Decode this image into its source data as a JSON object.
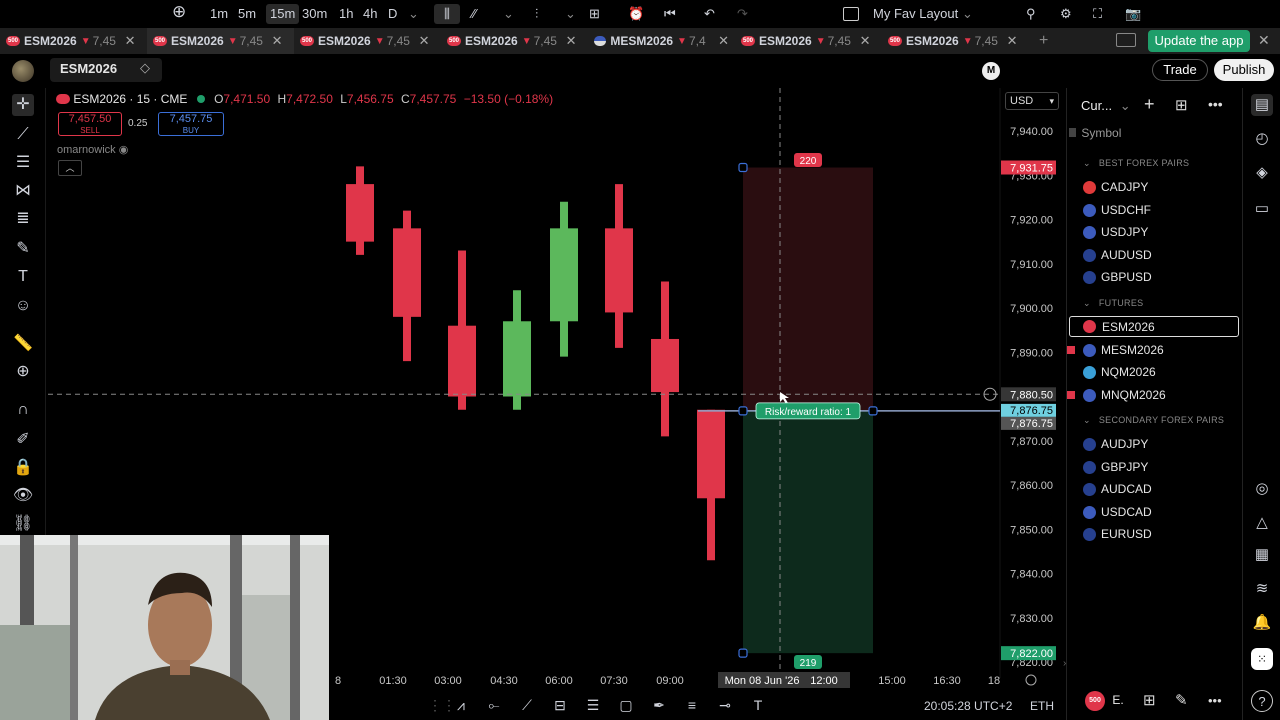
{
  "tabs": [
    {
      "symbol": "ESM2026",
      "price": "7,45",
      "logo": "500",
      "active": false
    },
    {
      "symbol": "ESM2026",
      "price": "7,45",
      "logo": "500",
      "active": true
    },
    {
      "symbol": "ESM2026",
      "price": "7,45",
      "logo": "500",
      "active": false
    },
    {
      "symbol": "ESM2026",
      "price": "7,45",
      "logo": "500",
      "active": false
    },
    {
      "symbol": "MESM2026",
      "price": "7,4",
      "logo": "flag",
      "active": false
    },
    {
      "symbol": "ESM2026",
      "price": "7,45",
      "logo": "500",
      "active": false
    },
    {
      "symbol": "ESM2026",
      "price": "7,45",
      "logo": "500",
      "active": false
    }
  ],
  "update_label": "Update the app",
  "toolbar": {
    "symbol": "ESM2026",
    "timeframes": [
      "1m",
      "5m",
      "15m",
      "30m",
      "1h",
      "4h",
      "D"
    ],
    "active_timeframe": "15m",
    "layout_name": "My Fav Layout",
    "layout_avatar": "M",
    "trade_label": "Trade",
    "publish_label": "Publish"
  },
  "chart": {
    "title": "ESM2026 · 15 · CME",
    "open_label": "O",
    "open": "7,471.50",
    "high_label": "H",
    "high": "7,472.50",
    "low_label": "L",
    "low": "7,456.75",
    "close_label": "C",
    "close": "7,457.75",
    "change": "−13.50 (−0.18%)",
    "sell_price": "7,457.50",
    "sell_label": "SELL",
    "buy_price": "7,457.75",
    "buy_label": "BUY",
    "spread": "0.25",
    "username": "omarnowick",
    "currency": "USD",
    "target_ticks": "220",
    "stop_ticks": "219",
    "rr_label": "Risk/reward ratio: 1",
    "crosshair_price": "7,880.50",
    "entry_price": "7,876.75",
    "entry_price_2": "7,876.75",
    "target_price": "7,931.75",
    "stop_price": "7,822.00",
    "crosshair_date": "Mon 08 Jun '26",
    "crosshair_time": "12:00",
    "y_ticks": [
      "7,940.00",
      "7,930.00",
      "7,920.00",
      "7,910.00",
      "7,900.00",
      "7,890.00",
      "7,870.00",
      "7,860.00",
      "7,850.00",
      "7,840.00",
      "7,830.00",
      "7,820.00"
    ],
    "x_ticks": [
      "8",
      "01:30",
      "03:00",
      "04:30",
      "06:00",
      "07:30",
      "09:00",
      "15:00",
      "16:30",
      "18"
    ]
  },
  "chart_data": {
    "type": "candlestick",
    "title": "ESM2026 · 15 · CME",
    "ylim": [
      7816,
      7944
    ],
    "candles": [
      {
        "open": 7928,
        "high": 7932,
        "low": 7912,
        "close": 7915,
        "dir": "down"
      },
      {
        "open": 7918,
        "high": 7922,
        "low": 7888,
        "close": 7898,
        "dir": "down"
      },
      {
        "open": 7896,
        "high": 7913,
        "low": 7877,
        "close": 7880,
        "dir": "down"
      },
      {
        "open": 7880,
        "high": 7904,
        "low": 7877,
        "close": 7897,
        "dir": "up"
      },
      {
        "open": 7897,
        "high": 7924,
        "low": 7889,
        "close": 7918,
        "dir": "up"
      },
      {
        "open": 7918,
        "high": 7928,
        "low": 7891,
        "close": 7899,
        "dir": "down"
      },
      {
        "open": 7893,
        "high": 7906,
        "low": 7871,
        "close": 7881,
        "dir": "down"
      },
      {
        "open": 7877,
        "high": 7877,
        "low": 7843,
        "close": 7857,
        "dir": "down"
      }
    ]
  },
  "right_panel": {
    "header": "Cur...",
    "symbol_col": "Symbol",
    "sections": [
      {
        "title": "BEST FOREX PAIRS",
        "items": [
          "CADJPY",
          "USDCHF",
          "USDJPY",
          "AUDUSD",
          "GBPUSD"
        ]
      },
      {
        "title": "FUTURES",
        "items": [
          "ESM2026",
          "MESM2026",
          "NQM2026",
          "MNQM2026"
        ]
      },
      {
        "title": "SECONDARY FOREX PAIRS",
        "items": [
          "AUDJPY",
          "GBPJPY",
          "AUDCAD",
          "USDCAD",
          "EURUSD"
        ]
      }
    ],
    "selected": "ESM2026",
    "bottom_symbol": "E."
  },
  "status": {
    "clock": "20:05:28 UTC+2",
    "session": "ETH"
  },
  "colors": {
    "up": "#5cb85c",
    "down": "#e0364a",
    "target_zone": "#2a0d10",
    "stop_zone": "#0d2a1c",
    "accent": "#1f9e6a"
  }
}
